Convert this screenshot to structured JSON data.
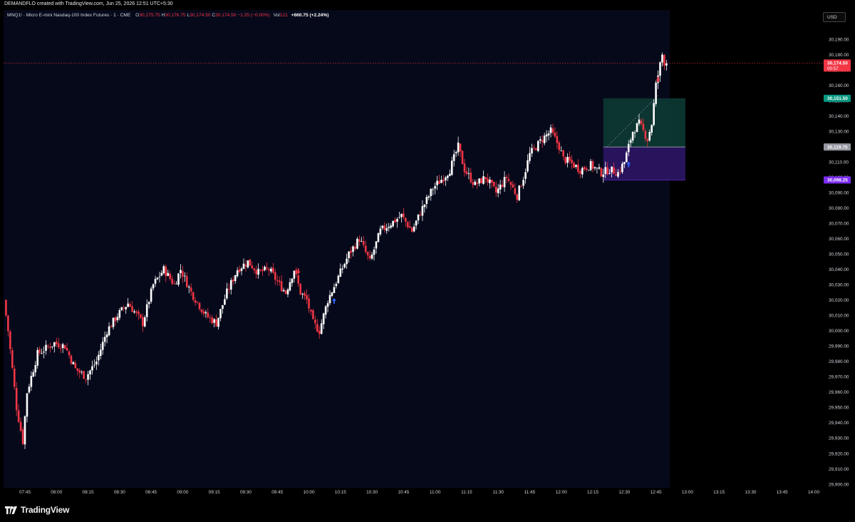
{
  "header": {
    "caption": "DEMANDFLO created with TradingView.com, Jun 25, 2026 12:51 UTC+5:30"
  },
  "legend": {
    "symbol": "MNQ1! · Micro E-mini Nasdaq-100 Index Futures · 1 · CME",
    "o_label": "O",
    "o_value": "30,175.75",
    "h_label": "H",
    "h_value": "30,176.75",
    "l_label": "L",
    "l_value": "30,174.50",
    "c_label": "C",
    "c_value": "30,174.50",
    "change": "−1.25 (−0.00%)",
    "vol_label": "Vol",
    "vol_value": "121",
    "day_change": "+660.75 (+2.24%)"
  },
  "currency": "USD",
  "branding": {
    "name": "TradingView",
    "icon": "tradingview-logo-icon"
  },
  "colors": {
    "background": "#06091a",
    "up": "#ffffff",
    "down": "#f23645",
    "profit_zone": "#0d3a33",
    "risk_zone": "#2a1561",
    "last_price": "#f23645",
    "target": "#089981",
    "stop": "#7b2cf0",
    "entry": "#9598a1"
  },
  "chart_data": {
    "type": "candlestick",
    "instrument": "MNQ1!",
    "timeframe": "1",
    "y_axis": {
      "ticks": [
        "29,900.00",
        "29,910.00",
        "29,920.00",
        "29,930.00",
        "29,940.00",
        "29,950.00",
        "29,960.00",
        "29,970.00",
        "29,980.00",
        "29,990.00",
        "30,000.00",
        "30,010.00",
        "30,020.00",
        "30,030.00",
        "30,040.00",
        "30,050.00",
        "30,060.00",
        "30,070.00",
        "30,080.00",
        "30,090.00",
        "30,100.00",
        "30,110.00",
        "30,120.00",
        "30,130.00",
        "30,140.00",
        "30,150.00",
        "30,160.00",
        "30,170.00",
        "30,180.00",
        "30,190.00"
      ],
      "range": [
        29900,
        30200
      ]
    },
    "x_axis": {
      "ticks": [
        "07:45",
        "08:00",
        "08:15",
        "08:30",
        "08:45",
        "09:00",
        "09:15",
        "09:30",
        "09:45",
        "10:00",
        "10:15",
        "10:30",
        "10:45",
        "11:00",
        "11:15",
        "11:30",
        "11:45",
        "12:00",
        "12:15",
        "12:30",
        "12:45",
        "13:00",
        "13:15",
        "13:30",
        "13:45",
        "14:00"
      ]
    },
    "trajectory": [
      [
        "07:36",
        30020
      ],
      [
        "07:38",
        30000
      ],
      [
        "07:42",
        29950
      ],
      [
        "07:45",
        29928
      ],
      [
        "07:47",
        29960
      ],
      [
        "07:52",
        29985
      ],
      [
        "08:00",
        29992
      ],
      [
        "08:05",
        29990
      ],
      [
        "08:10",
        29975
      ],
      [
        "08:15",
        29970
      ],
      [
        "08:20",
        29980
      ],
      [
        "08:25",
        30000
      ],
      [
        "08:30",
        30010
      ],
      [
        "08:35",
        30018
      ],
      [
        "08:42",
        30005
      ],
      [
        "08:47",
        30030
      ],
      [
        "08:52",
        30040
      ],
      [
        "08:57",
        30030
      ],
      [
        "09:00",
        30040
      ],
      [
        "09:05",
        30025
      ],
      [
        "09:12",
        30010
      ],
      [
        "09:17",
        30005
      ],
      [
        "09:22",
        30025
      ],
      [
        "09:27",
        30040
      ],
      [
        "09:32",
        30045
      ],
      [
        "09:37",
        30038
      ],
      [
        "09:42",
        30040
      ],
      [
        "09:47",
        30030
      ],
      [
        "09:50",
        30025
      ],
      [
        "09:54",
        30040
      ],
      [
        "09:57",
        30025
      ],
      [
        "10:00",
        30020
      ],
      [
        "10:03",
        30005
      ],
      [
        "10:06",
        30000
      ],
      [
        "10:10",
        30020
      ],
      [
        "10:15",
        30035
      ],
      [
        "10:20",
        30050
      ],
      [
        "10:25",
        30060
      ],
      [
        "10:30",
        30045
      ],
      [
        "10:35",
        30065
      ],
      [
        "10:40",
        30070
      ],
      [
        "10:45",
        30075
      ],
      [
        "10:50",
        30065
      ],
      [
        "10:55",
        30080
      ],
      [
        "11:00",
        30093
      ],
      [
        "11:05",
        30100
      ],
      [
        "11:08",
        30105
      ],
      [
        "11:12",
        30120
      ],
      [
        "11:15",
        30105
      ],
      [
        "11:20",
        30095
      ],
      [
        "11:25",
        30100
      ],
      [
        "11:30",
        30090
      ],
      [
        "11:35",
        30100
      ],
      [
        "11:40",
        30088
      ],
      [
        "11:43",
        30100
      ],
      [
        "11:46",
        30115
      ],
      [
        "11:52",
        30125
      ],
      [
        "11:56",
        30130
      ],
      [
        "12:00",
        30120
      ],
      [
        "12:02",
        30112
      ],
      [
        "12:05",
        30110
      ],
      [
        "12:10",
        30105
      ],
      [
        "12:15",
        30108
      ],
      [
        "12:20",
        30103
      ],
      [
        "12:24",
        30105
      ],
      [
        "12:28",
        30103
      ],
      [
        "12:31",
        30110
      ],
      [
        "12:35",
        30130
      ],
      [
        "12:38",
        30135
      ],
      [
        "12:42",
        30125
      ],
      [
        "12:44",
        30135
      ],
      [
        "12:46",
        30160
      ],
      [
        "12:49",
        30180
      ],
      [
        "12:50",
        30175
      ]
    ],
    "last_price": {
      "value": "30,174.50",
      "countdown": "00:57"
    },
    "long_position": {
      "start": "12:20",
      "end": "12:59",
      "target": "30,151.50",
      "entry": "30,119.75",
      "stop": "30,098.25"
    },
    "signals": [
      {
        "time": "09:55",
        "type": "down-arrow-icon"
      },
      {
        "time": "10:12",
        "type": "up-arrow-icon"
      },
      {
        "time": "12:32",
        "type": "up-arrow-icon"
      },
      {
        "time": "12:46",
        "type": "down-arrow-icon"
      }
    ]
  }
}
